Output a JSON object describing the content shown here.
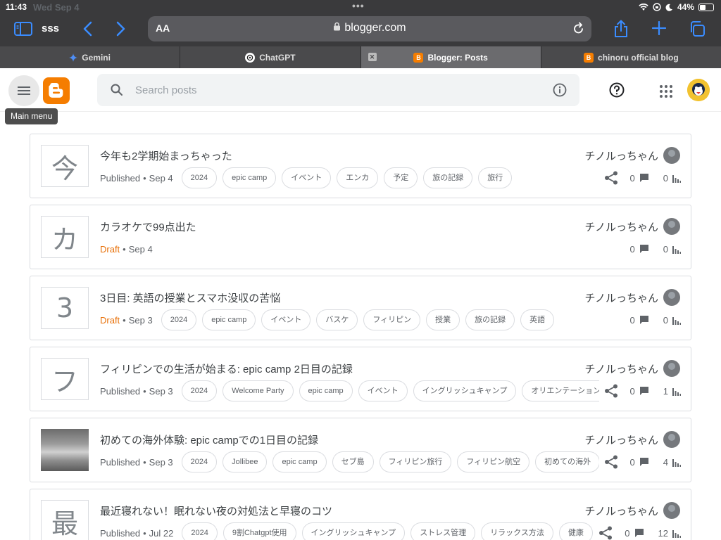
{
  "status_bar": {
    "time": "11:43",
    "date": "Wed Sep 4",
    "battery": "44%",
    "battery_level": 0.44
  },
  "safari": {
    "tab_group": "sss",
    "url": "blogger.com",
    "text_size_label": "AA",
    "tabs": [
      {
        "label": "Gemini",
        "favicon": "gemini-icon",
        "active": false
      },
      {
        "label": "ChatGPT",
        "favicon": "chatgpt-icon",
        "active": false
      },
      {
        "label": "Blogger: Posts",
        "favicon": "blogger-icon",
        "active": true
      },
      {
        "label": "chinoru official blog",
        "favicon": "blogger-icon",
        "active": false
      }
    ]
  },
  "app": {
    "search_placeholder": "Search posts",
    "tooltip": "Main menu",
    "brand_color": "#f57d00"
  },
  "posts": [
    {
      "thumb": "今",
      "title": "今年も2学期始まっちゃった",
      "status": "Published",
      "date": "Sep 4",
      "labels": [
        "2024",
        "epic camp",
        "イベント",
        "エンカ",
        "予定",
        "旅の記録",
        "旅行"
      ],
      "author": "チノルっちゃん",
      "share": true,
      "comments": "0",
      "views": "0"
    },
    {
      "thumb": "カ",
      "title": "カラオケで99点出た",
      "status": "Draft",
      "date": "Sep 4",
      "labels": [],
      "author": "チノルっちゃん",
      "share": false,
      "comments": "0",
      "views": "0"
    },
    {
      "thumb": "3",
      "title": "3日目: 英語の授業とスマホ没収の苦悩",
      "status": "Draft",
      "date": "Sep 3",
      "labels": [
        "2024",
        "epic camp",
        "イベント",
        "バスケ",
        "フィリピン",
        "授業",
        "旅の記録",
        "英語"
      ],
      "author": "チノルっちゃん",
      "share": false,
      "comments": "0",
      "views": "0"
    },
    {
      "thumb": "フ",
      "title": "フィリピンでの生活が始まる: epic camp 2日目の記録",
      "status": "Published",
      "date": "Sep 3",
      "labels": [
        "2024",
        "Welcome Party",
        "epic camp",
        "イベント",
        "イングリッシュキャンプ",
        "オリエンテーション"
      ],
      "author": "チノルっちゃん",
      "share": true,
      "comments": "0",
      "views": "1"
    },
    {
      "thumb": "",
      "photo": true,
      "title": "初めての海外体験: epic campでの1日目の記録",
      "status": "Published",
      "date": "Sep 3",
      "labels": [
        "2024",
        "Jollibee",
        "epic camp",
        "セブ島",
        "フィリピン旅行",
        "フィリピン航空",
        "初めての海外"
      ],
      "author": "チノルっちゃん",
      "share": true,
      "comments": "0",
      "views": "4"
    },
    {
      "thumb": "最",
      "title": "最近寝れない！眠れない夜の対処法と早寝のコツ",
      "status": "Published",
      "date": "Jul 22",
      "labels": [
        "2024",
        "9割Chatgpt使用",
        "イングリッシュキャンプ",
        "ストレス管理",
        "リラックス方法",
        "健康"
      ],
      "author": "チノルっちゃん",
      "share": true,
      "comments": "0",
      "views": "12"
    }
  ]
}
